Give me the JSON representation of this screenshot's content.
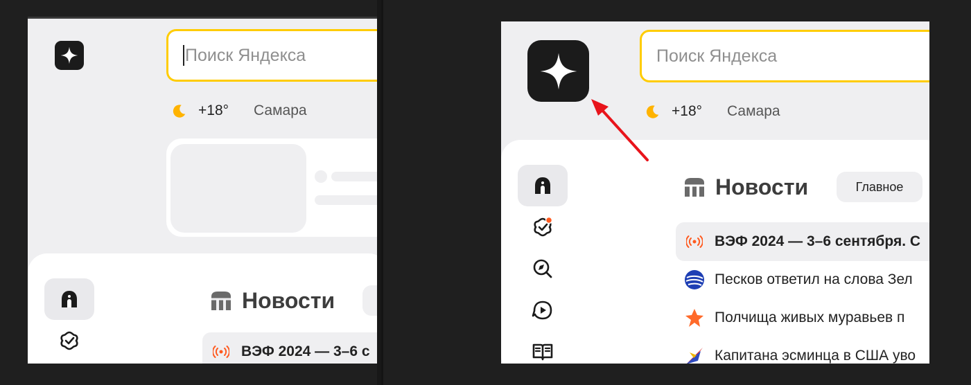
{
  "search": {
    "placeholder": "Поиск Яндекса"
  },
  "weather": {
    "temperature": "+18°",
    "city": "Самара",
    "icon": "moon-icon"
  },
  "news": {
    "title": "Новости",
    "tab_main": "Главное",
    "left_first_item": "ВЭФ 2024 — 3–6 с",
    "items": [
      {
        "text": "ВЭФ 2024 — 3–6 сентября. С",
        "source_icon": "live-broadcast-icon",
        "bold": true
      },
      {
        "text": "Песков ответил на слова Зел",
        "source_icon": "globe-source-icon"
      },
      {
        "text": "Полчища живых муравьев п",
        "source_icon": "star-source-icon"
      },
      {
        "text": "Капитана эсминца в США уво",
        "source_icon": "bird-source-icon"
      }
    ]
  },
  "nav": [
    "home-icon",
    "tasks-icon",
    "explore-icon",
    "video-icon",
    "book-icon"
  ],
  "colors": {
    "search_border": "#ffcc00",
    "logo_bg": "#1b1b1b",
    "page_bg": "#efeff1",
    "annotation_arrow": "#e8141b",
    "badge": "#ff5a1f",
    "live": "#ff5a1f"
  }
}
